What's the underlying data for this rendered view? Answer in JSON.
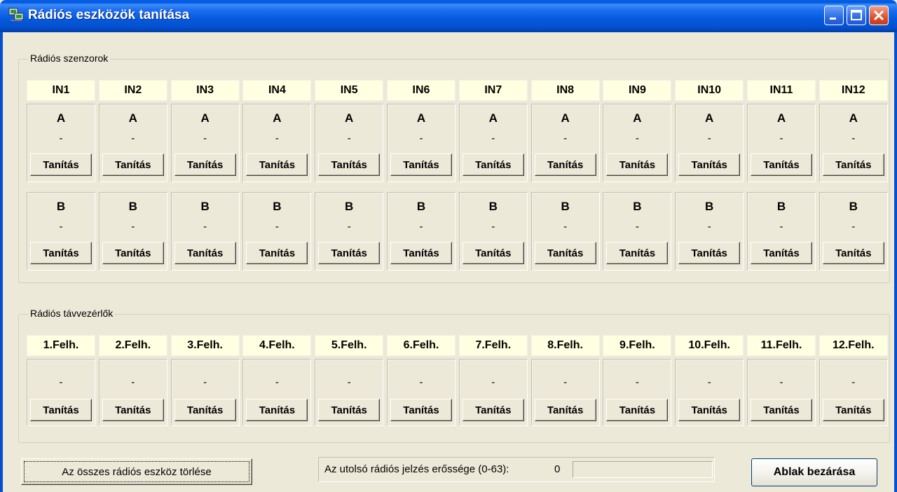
{
  "window": {
    "title": "Rádiós eszközök tanítása"
  },
  "sensors": {
    "group_label": "Rádiós szenzorok",
    "columns": [
      {
        "header": "IN1",
        "a_label": "A",
        "a_value": "-",
        "b_label": "B",
        "b_value": "-"
      },
      {
        "header": "IN2",
        "a_label": "A",
        "a_value": "-",
        "b_label": "B",
        "b_value": "-"
      },
      {
        "header": "IN3",
        "a_label": "A",
        "a_value": "-",
        "b_label": "B",
        "b_value": "-"
      },
      {
        "header": "IN4",
        "a_label": "A",
        "a_value": "-",
        "b_label": "B",
        "b_value": "-"
      },
      {
        "header": "IN5",
        "a_label": "A",
        "a_value": "-",
        "b_label": "B",
        "b_value": "-"
      },
      {
        "header": "IN6",
        "a_label": "A",
        "a_value": "-",
        "b_label": "B",
        "b_value": "-"
      },
      {
        "header": "IN7",
        "a_label": "A",
        "a_value": "-",
        "b_label": "B",
        "b_value": "-"
      },
      {
        "header": "IN8",
        "a_label": "A",
        "a_value": "-",
        "b_label": "B",
        "b_value": "-"
      },
      {
        "header": "IN9",
        "a_label": "A",
        "a_value": "-",
        "b_label": "B",
        "b_value": "-"
      },
      {
        "header": "IN10",
        "a_label": "A",
        "a_value": "-",
        "b_label": "B",
        "b_value": "-"
      },
      {
        "header": "IN11",
        "a_label": "A",
        "a_value": "-",
        "b_label": "B",
        "b_value": "-"
      },
      {
        "header": "IN12",
        "a_label": "A",
        "a_value": "-",
        "b_label": "B",
        "b_value": "-"
      }
    ],
    "teach_label": "Tanítás"
  },
  "remotes": {
    "group_label": "Rádiós távvezérlők",
    "columns": [
      {
        "header": "1.Felh.",
        "value": "-"
      },
      {
        "header": "2.Felh.",
        "value": "-"
      },
      {
        "header": "3.Felh.",
        "value": "-"
      },
      {
        "header": "4.Felh.",
        "value": "-"
      },
      {
        "header": "5.Felh.",
        "value": "-"
      },
      {
        "header": "6.Felh.",
        "value": "-"
      },
      {
        "header": "7.Felh.",
        "value": "-"
      },
      {
        "header": "8.Felh.",
        "value": "-"
      },
      {
        "header": "9.Felh.",
        "value": "-"
      },
      {
        "header": "10.Felh.",
        "value": "-"
      },
      {
        "header": "11.Felh.",
        "value": "-"
      },
      {
        "header": "12.Felh.",
        "value": "-"
      }
    ],
    "teach_label": "Tanítás"
  },
  "footer": {
    "delete_all_label": "Az összes rádiós eszköz törlése",
    "signal_label": "Az utolsó rádiós jelzés erőssége (0-63):",
    "signal_value": "0",
    "signal_level": 0,
    "close_label": "Ablak bezárása"
  },
  "icons": {
    "app": "network-computers-icon",
    "minimize": "minimize-icon",
    "maximize": "maximize-icon",
    "close": "close-icon"
  }
}
